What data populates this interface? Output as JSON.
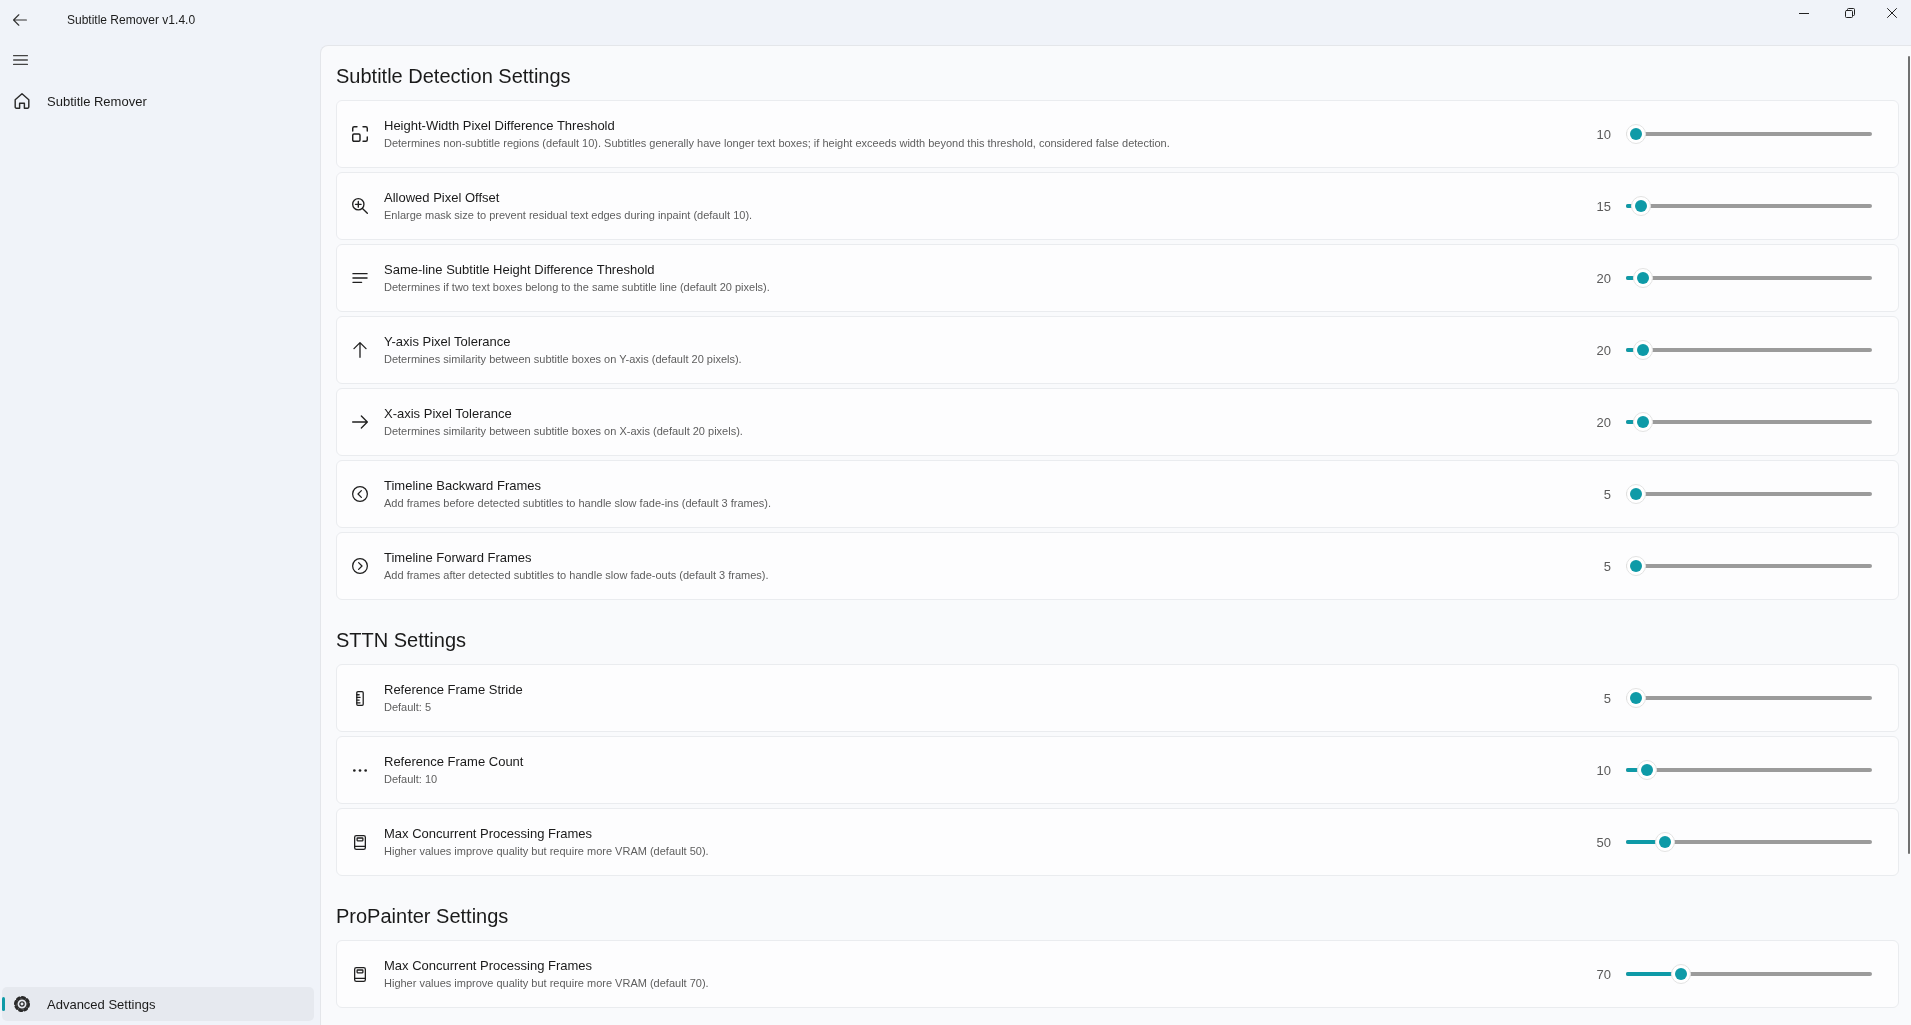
{
  "window": {
    "title": "Subtitle Remover v1.4.0"
  },
  "sidebar": {
    "items": [
      {
        "label": "Subtitle Remover",
        "selected": false
      }
    ],
    "footer_items": [
      {
        "label": "Advanced Settings",
        "selected": true
      }
    ]
  },
  "sections": [
    {
      "title": "Subtitle Detection Settings",
      "settings": [
        {
          "title": "Height-Width Pixel Difference Threshold",
          "description": "Determines non-subtitle regions (default 10). Subtitles generally have longer text boxes; if height exceeds width beyond this threshold, considered false detection.",
          "value": "10",
          "level": 0
        },
        {
          "title": "Allowed Pixel Offset",
          "description": "Enlarge mask size to prevent residual text edges during inpaint (default 10).",
          "value": "15",
          "level": 0.02
        },
        {
          "title": "Same-line Subtitle Height Difference Threshold",
          "description": "Determines if two text boxes belong to the same subtitle line (default 20 pixels).",
          "value": "20",
          "level": 0.03
        },
        {
          "title": "Y-axis Pixel Tolerance",
          "description": "Determines similarity between subtitle boxes on Y-axis (default 20 pixels).",
          "value": "20",
          "level": 0.03
        },
        {
          "title": "X-axis Pixel Tolerance",
          "description": "Determines similarity between subtitle boxes on X-axis (default 20 pixels).",
          "value": "20",
          "level": 0.03
        },
        {
          "title": "Timeline Backward Frames",
          "description": "Add frames before detected subtitles to handle slow fade-ins (default 3 frames).",
          "value": "5",
          "level": 0
        },
        {
          "title": "Timeline Forward Frames",
          "description": "Add frames after detected subtitles to handle slow fade-outs (default 3 frames).",
          "value": "5",
          "level": 0
        }
      ]
    },
    {
      "title": "STTN Settings",
      "settings": [
        {
          "title": "Reference Frame Stride",
          "description": "Default: 5",
          "value": "5",
          "level": 0
        },
        {
          "title": "Reference Frame Count",
          "description": "Default: 10",
          "value": "10",
          "level": 0.05
        },
        {
          "title": "Max Concurrent Processing Frames",
          "description": "Higher values improve quality but require more VRAM (default 50).",
          "value": "50",
          "level": 0.13
        }
      ]
    },
    {
      "title": "ProPainter Settings",
      "settings": [
        {
          "title": "Max Concurrent Processing Frames",
          "description": "Higher values improve quality but require more VRAM (default 70).",
          "value": "70",
          "level": 0.2
        }
      ]
    }
  ]
}
